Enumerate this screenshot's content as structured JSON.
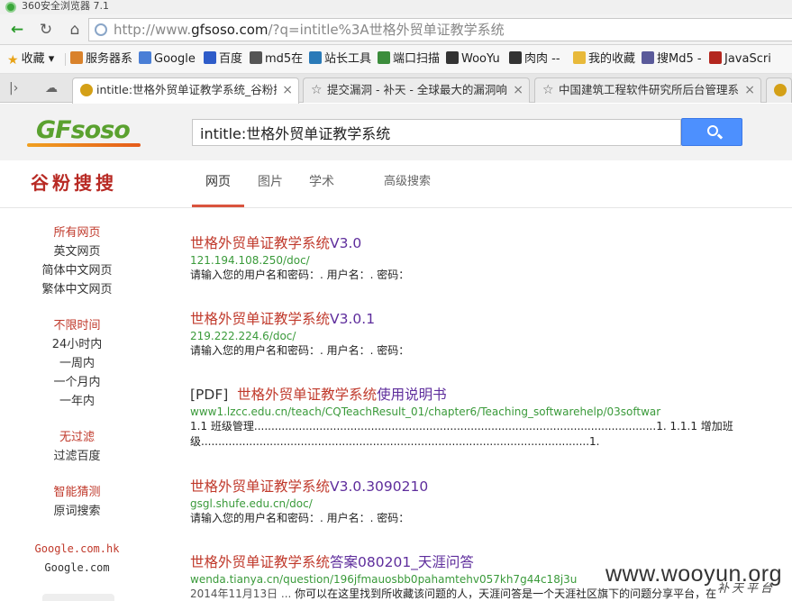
{
  "window": {
    "title": "360安全浏览器 7.1"
  },
  "address": {
    "prefix": "http://www.",
    "host": "gfsoso.com",
    "path": "/?q=intitle%3A世格外贸单证教学系统"
  },
  "bookmarks": [
    {
      "label": "收藏",
      "icon": "star-icon",
      "color": "#e8a317"
    },
    {
      "label": "服务器系",
      "icon": "server-icon",
      "color": "#d9822b"
    },
    {
      "label": "Google",
      "icon": "google-icon",
      "color": "#4a7fd6"
    },
    {
      "label": "百度",
      "icon": "baidu-icon",
      "color": "#2e5cc9"
    },
    {
      "label": "md5在",
      "icon": "grid-icon",
      "color": "#555555"
    },
    {
      "label": "站长工具",
      "icon": "tool-icon",
      "color": "#2a7ab8"
    },
    {
      "label": "端口扫描",
      "icon": "port-icon",
      "color": "#3c8d3c"
    },
    {
      "label": "WooYu",
      "icon": "wooyun-icon",
      "color": "#333333"
    },
    {
      "label": "肉肉 --",
      "icon": "wooyun-icon",
      "color": "#333333"
    },
    {
      "label": "我的收藏",
      "icon": "folder-icon",
      "color": "#e8b93a"
    },
    {
      "label": "搜Md5 -",
      "icon": "md5-icon",
      "color": "#5a5a9a"
    },
    {
      "label": "JavaScri",
      "icon": "w3-icon",
      "color": "#b3261e"
    }
  ],
  "tabs": [
    {
      "label": "intitle:世格外贸单证教学系统_谷粉搜搜",
      "active": true
    },
    {
      "label": "提交漏洞 - 补天 - 全球最大的漏洞响应",
      "active": false
    },
    {
      "label": "中国建筑工程软件研究所后台管理系统",
      "active": false
    }
  ],
  "search": {
    "query": "intitle:世格外贸单证教学系统"
  },
  "brand": {
    "logo_g": "GF",
    "logo_rest": "soso",
    "cn_name": "谷粉搜搜"
  },
  "nav": {
    "web": "网页",
    "images": "图片",
    "scholar": "学术",
    "advanced": "高级搜索"
  },
  "sidebar": {
    "lang_all": "所有网页",
    "lang_en": "英文网页",
    "lang_zh_simple": "简体中文网页",
    "lang_zh_trad": "繁体中文网页",
    "time_any": "不限时间",
    "time_24h": "24小时内",
    "time_week": "一周内",
    "time_month": "一个月内",
    "time_year": "一年内",
    "filter_none": "无过滤",
    "filter_baidu": "过滤百度",
    "guess_smart": "智能猜测",
    "guess_orig": "原词搜索",
    "domain_hk": "Google.com.hk",
    "domain_com": "Google.com"
  },
  "results": [
    {
      "title_hl": "世格外贸单证教学系统",
      "title_rest": "V3.0",
      "url": "121.194.108.250/doc/",
      "snippet": "请输入您的用户名和密码：. 用户名：. 密码："
    },
    {
      "title_hl": "世格外贸单证教学系统",
      "title_rest": "V3.0.1",
      "url": "219.222.224.6/doc/",
      "snippet": "请输入您的用户名和密码：. 用户名：. 密码："
    },
    {
      "title_pre": "[PDF]",
      "title_hl": "世格外贸单证教学系统",
      "title_rest": "使用说明书",
      "url": "www1.lzcc.edu.cn/teach/CQTeachResult_01/chapter6/Teaching_softwarehelp/03softwar",
      "snippet": "1.1 班级管理.....................................................................................................................1. 1.1.1 增加班级.................................................................................................................1."
    },
    {
      "title_hl": "世格外贸单证教学系统",
      "title_rest": "V3.0.3090210",
      "url": "gsgl.shufe.edu.cn/doc/",
      "snippet": "请输入您的用户名和密码：. 用户名：. 密码："
    },
    {
      "title_hl": "世格外贸单证教学系统",
      "title_rest": "答案080201_天涯问答",
      "url": "wenda.tianya.cn/question/196jfmauosbb0pahamtehv057kh7g44c18j3u",
      "date": "2014年11月13日 ...",
      "snippet": "你可以在这里找到所收藏该问题的人，天涯问答是一个天涯社区旗下的问题分享平台，在"
    }
  ],
  "watermark": {
    "site": "www.wooyun.org",
    "cn": "补天平台"
  }
}
